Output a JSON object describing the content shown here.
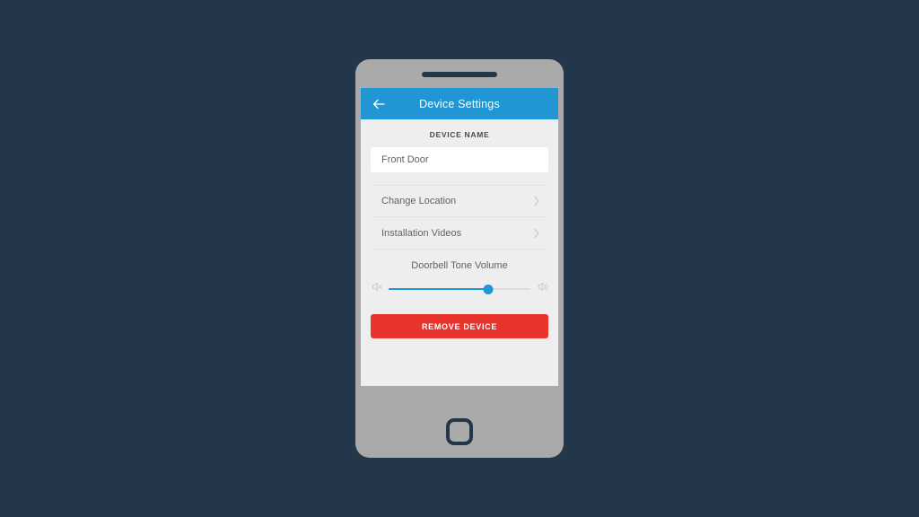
{
  "app": {
    "header": {
      "title": "Device Settings",
      "back_icon": "arrow-left-icon",
      "background_color": "#2196d4",
      "title_color": "#ffffff"
    },
    "screen_background": "#eeeeee"
  },
  "device_name_section": {
    "label": "DEVICE NAME",
    "input_value": "Front Door",
    "input_placeholder": "Device name"
  },
  "nav_rows": [
    {
      "label": "Change Location",
      "chevron_icon": "chevron-right-icon"
    },
    {
      "label": "Installation Videos",
      "chevron_icon": "chevron-right-icon"
    }
  ],
  "volume_section": {
    "title": "Doorbell Tone Volume",
    "mute_icon": "speaker-mute-icon",
    "loud_icon": "speaker-volume-icon",
    "value_percent": 70,
    "min": 0,
    "max": 100,
    "fill_color": "#2196d4",
    "track_color": "#dcdcdc"
  },
  "actions": {
    "remove_device_label": "REMOVE DEVICE",
    "remove_device_color": "#e8342c"
  },
  "device_frame": {
    "body_color": "#aaaaaa",
    "accent_color": "#24374a",
    "home_button_icon": "home-button-icon",
    "earpiece_icon": "earpiece-speaker-icon"
  },
  "page": {
    "background_color": "#24374a"
  }
}
